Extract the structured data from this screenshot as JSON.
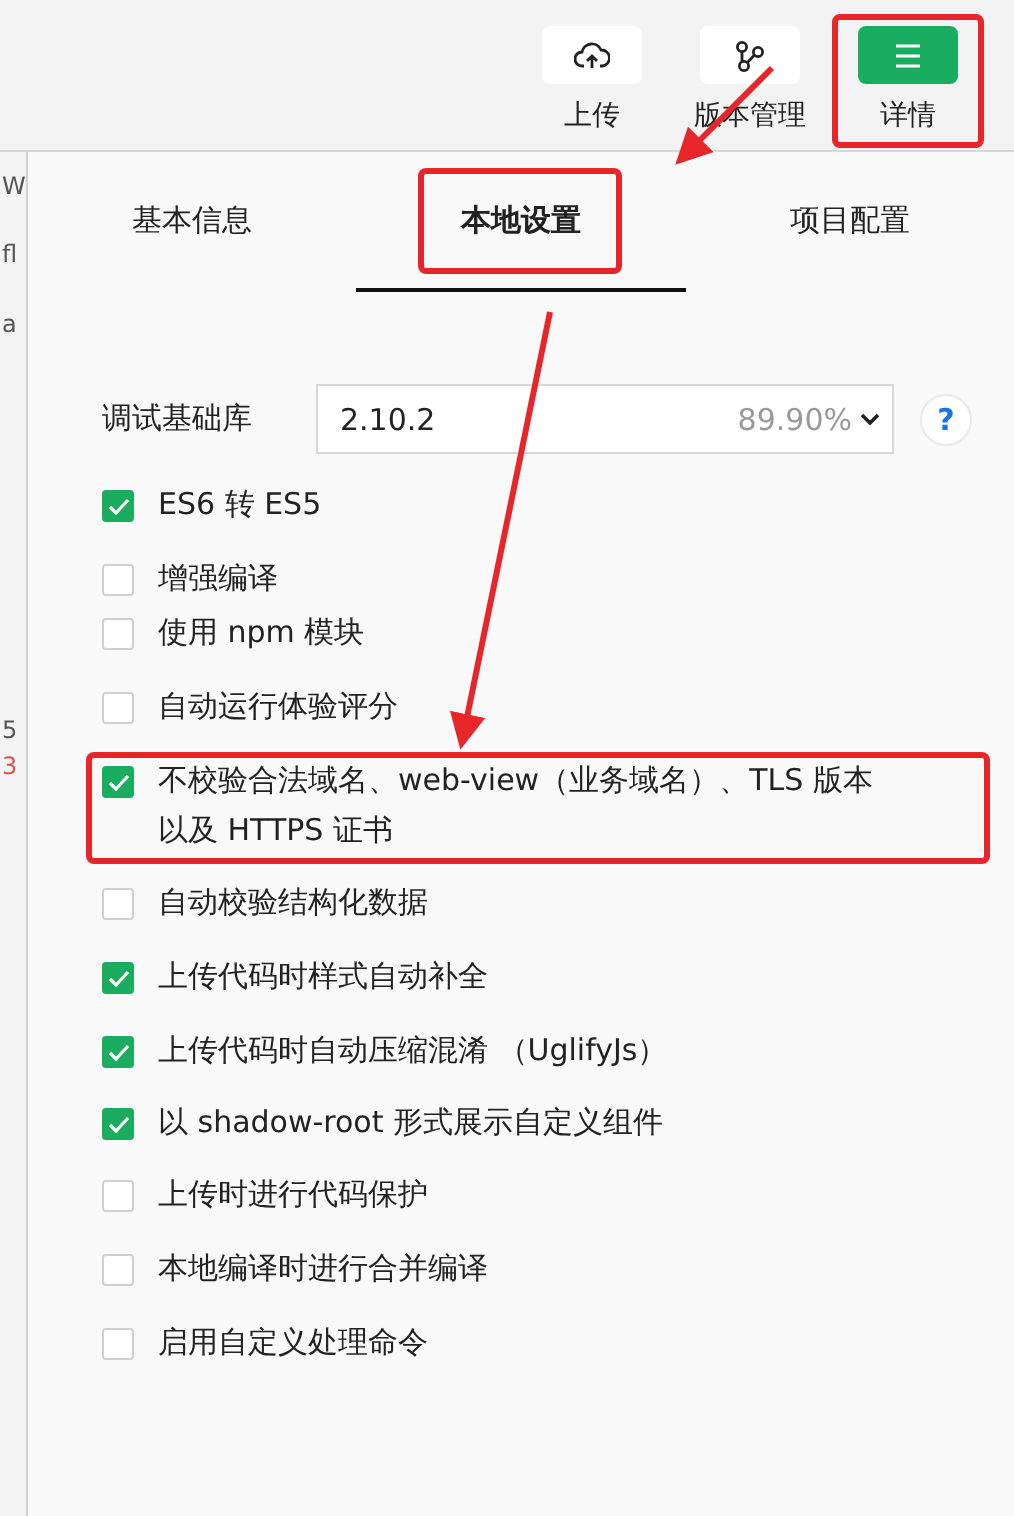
{
  "toolbar": [
    {
      "kind": "upload",
      "label": "上传",
      "primary": false,
      "highlighted": false
    },
    {
      "kind": "version",
      "label": "版本管理",
      "primary": false,
      "highlighted": false
    },
    {
      "kind": "details",
      "label": "详情",
      "primary": true,
      "highlighted": true
    }
  ],
  "left_strip": [
    {
      "text": "W",
      "color": "#555555"
    },
    {
      "text": "fl",
      "color": "#555555"
    },
    {
      "text": "a",
      "color": "#555555"
    },
    {
      "text": "5",
      "color": "#555555"
    },
    {
      "text": "3",
      "color": "#d9534f"
    }
  ],
  "tabs": [
    {
      "label": "基本信息",
      "selected": false,
      "highlighted": false
    },
    {
      "label": "本地设置",
      "selected": true,
      "highlighted": true
    },
    {
      "label": "项目配置",
      "selected": false,
      "highlighted": false
    }
  ],
  "debug_library": {
    "label": "调试基础库",
    "value": "2.10.2",
    "share": "89.90%",
    "help": "?"
  },
  "options": [
    {
      "label": "ES6 转 ES5",
      "checked": true,
      "highlighted": false
    },
    {
      "label": "增强编译",
      "checked": false,
      "highlighted": false
    },
    {
      "label": "使用 npm 模块",
      "checked": false,
      "highlighted": false
    },
    {
      "label": "自动运行体验评分",
      "checked": false,
      "highlighted": false
    },
    {
      "label": "不校验合法域名、web-view（业务域名）、TLS 版本以及 HTTPS 证书",
      "checked": true,
      "highlighted": true
    },
    {
      "label": "自动校验结构化数据",
      "checked": false,
      "highlighted": false
    },
    {
      "label": "上传代码时样式自动补全",
      "checked": true,
      "highlighted": false
    },
    {
      "label": "上传代码时自动压缩混淆 （UglifyJs）",
      "checked": true,
      "highlighted": false
    },
    {
      "label": "以 shadow-root 形式展示自定义组件",
      "checked": true,
      "highlighted": false
    },
    {
      "label": "上传时进行代码保护",
      "checked": false,
      "highlighted": false
    },
    {
      "label": "本地编译时进行合并编译",
      "checked": false,
      "highlighted": false
    },
    {
      "label": "启用自定义处理命令",
      "checked": false,
      "highlighted": false
    }
  ]
}
